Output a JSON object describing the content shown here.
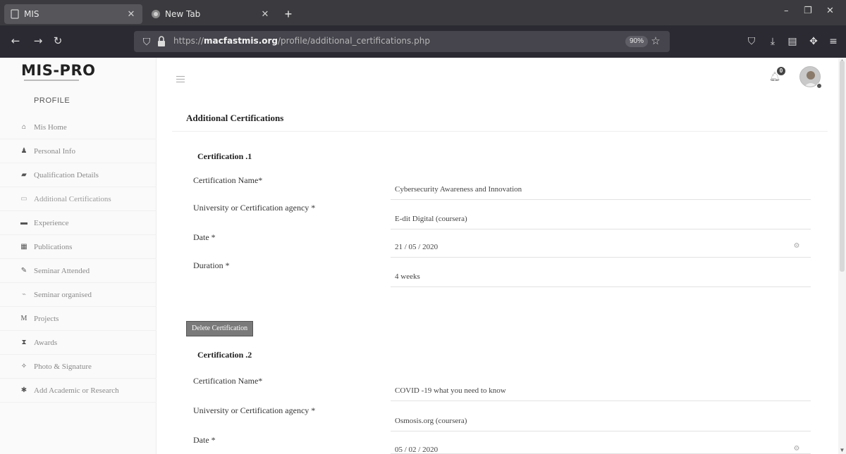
{
  "browser": {
    "tabs": [
      {
        "title": "MIS",
        "active": true
      },
      {
        "title": "New Tab",
        "active": false
      }
    ],
    "url_prefix": "https://",
    "url_domain": "macfastmis.org",
    "url_path": "/profile/additional_certifications.php",
    "zoom": "90%"
  },
  "app": {
    "logo": "MIS-PRO",
    "notification_count": "0"
  },
  "sidebar": {
    "heading": "PROFILE",
    "items": [
      {
        "label": "Mis Home",
        "icon": "home-icon"
      },
      {
        "label": "Personal Info",
        "icon": "user-icon"
      },
      {
        "label": "Qualification Details",
        "icon": "graduation-cap-icon"
      },
      {
        "label": "Additional Certifications",
        "icon": "certificate-icon",
        "active": true
      },
      {
        "label": "Experience",
        "icon": "briefcase-icon"
      },
      {
        "label": "Publications",
        "icon": "book-icon"
      },
      {
        "label": "Seminar Attended",
        "icon": "seminar-icon"
      },
      {
        "label": "Seminar organised",
        "icon": "presentation-icon"
      },
      {
        "label": "Projects",
        "icon": "project-icon"
      },
      {
        "label": "Awards",
        "icon": "award-icon"
      },
      {
        "label": "Photo & Signature",
        "icon": "photo-icon"
      },
      {
        "label": "Add Academic or Research",
        "icon": "plus-icon"
      }
    ]
  },
  "main": {
    "title": "Additional Certifications",
    "delete_button": "Delete Certification",
    "labels": {
      "name": "Certification Name*",
      "agency": "University or Certification agency *",
      "date": "Date *",
      "duration": "Duration *"
    },
    "certifications": [
      {
        "heading": "Certification .1",
        "name": "Cybersecurity Awareness and Innovation",
        "agency": "E-dit Digital (coursera)",
        "date": "21 / 05 / 2020",
        "duration": "4 weeks"
      },
      {
        "heading": "Certification .2",
        "name": "COVID -19 what you need to know",
        "agency": "Osmosis.org (coursera)",
        "date": "05 / 02 / 2020"
      }
    ]
  }
}
